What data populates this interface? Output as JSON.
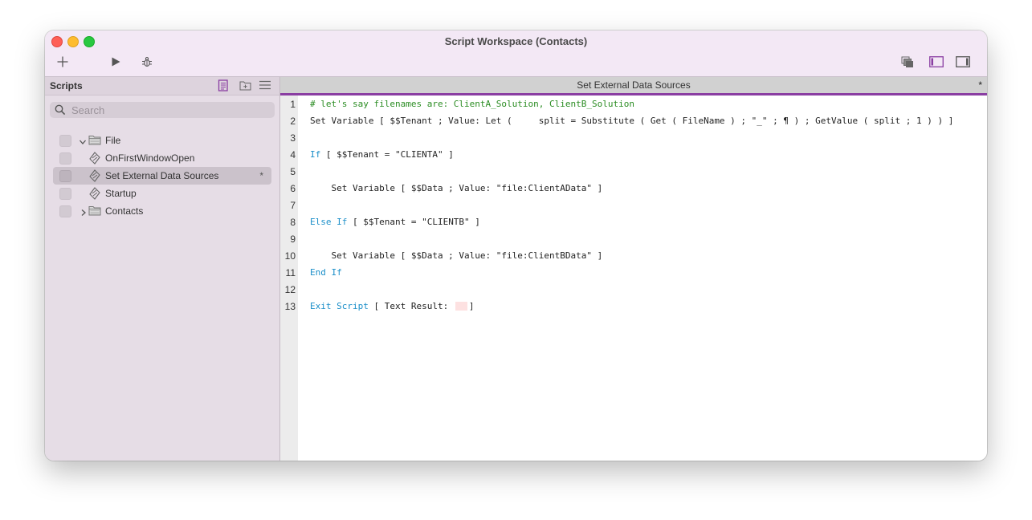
{
  "window": {
    "title": "Script Workspace (Contacts)"
  },
  "toolbar": {
    "new_icon": "plus-icon",
    "run_icon": "play-icon",
    "debug_icon": "bug-icon",
    "right_icons": [
      "window-stack-icon",
      "left-panel-icon",
      "right-panel-icon"
    ]
  },
  "sidebar": {
    "title": "Scripts",
    "header_icons": [
      "new-script-icon",
      "new-folder-icon",
      "separator-icon"
    ],
    "search": {
      "placeholder": "Search",
      "value": ""
    },
    "items": [
      {
        "label": "File",
        "type": "folder",
        "expanded": true,
        "indent": 0
      },
      {
        "label": "OnFirstWindowOpen",
        "type": "script",
        "indent": 1
      },
      {
        "label": "Set External Data Sources",
        "type": "script",
        "indent": 1,
        "selected": true,
        "modified_marker": "*"
      },
      {
        "label": "Startup",
        "type": "script",
        "indent": 1
      },
      {
        "label": "Contacts",
        "type": "folder",
        "expanded": false,
        "indent": 0
      }
    ]
  },
  "editor": {
    "title": "Set External Data Sources",
    "modified_marker": "*",
    "lines": [
      {
        "num": "1",
        "comment": "# let's say filenames are: ClientA_Solution, ClientB_Solution"
      },
      {
        "num": "2",
        "text": "Set Variable [ $$Tenant ; Value: Let (     split = Substitute ( Get ( FileName ) ; \"_\" ; ¶ ) ; GetValue ( split ; 1 ) ) ]"
      },
      {
        "num": "3",
        "text": ""
      },
      {
        "num": "4",
        "keyword": "If",
        "text": " [ $$Tenant = \"CLIENTA\" ]"
      },
      {
        "num": "5",
        "text": ""
      },
      {
        "num": "6",
        "text": "    Set Variable [ $$Data ; Value: \"file:ClientAData\" ]"
      },
      {
        "num": "7",
        "text": ""
      },
      {
        "num": "8",
        "keyword": "Else If",
        "text": " [ $$Tenant = \"CLIENTB\" ]"
      },
      {
        "num": "9",
        "text": ""
      },
      {
        "num": "10",
        "text": "    Set Variable [ $$Data ; Value: \"file:ClientBData\" ]"
      },
      {
        "num": "11",
        "keyword": "End If",
        "text": ""
      },
      {
        "num": "12",
        "text": ""
      },
      {
        "num": "13",
        "keyword": "Exit Script",
        "text": " [ Text Result: ",
        "after": "]"
      }
    ]
  },
  "colors": {
    "accent": "#8a3ea2",
    "keyword": "#1b8fc9",
    "comment": "#2a8c22",
    "titlebar": "#f3e8f5",
    "sidebar": "#e6dde6"
  }
}
